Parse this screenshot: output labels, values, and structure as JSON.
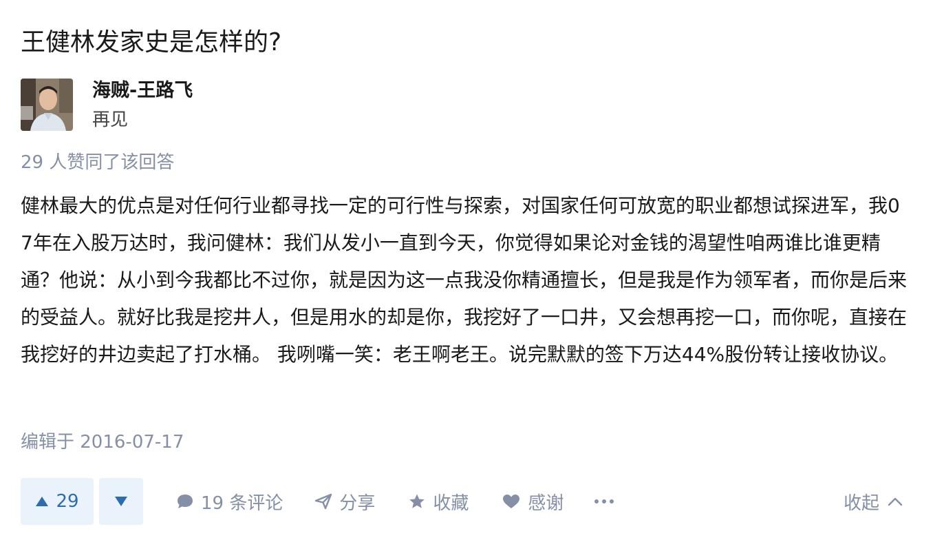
{
  "question": {
    "title": "王健林发家史是怎样的?"
  },
  "author": {
    "name": "海贼-王路飞",
    "bio": "再见"
  },
  "vote_summary": "29 人赞同了该回答",
  "answer": {
    "paragraph": "健林最大的优点是对任何行业都寻找一定的可行性与探索，对国家任何可放宽的职业都想试探进军，我07年在入股万达时，我问健林：我们从发小一直到今天，你觉得如果论对金钱的渴望性咱两谁比谁更精通？他说：从小到今我都比不过你，就是因为这一点我没你精通擅长，但是我是作为领军者，而你是后来的受益人。就好比我是挖井人，但是用水的却是你，我挖好了一口井，又会想再挖一口，而你呢，直接在我挖好的井边卖起了打水桶。 我咧嘴一笑：老王啊老王。说完默默的签下万达44%股份转让接收协议。"
  },
  "edit_time": "编辑于 2016-07-17",
  "actions": {
    "upvote_count": "29",
    "comment_label": "19 条评论",
    "share_label": "分享",
    "favorite_label": "收藏",
    "thanks_label": "感谢",
    "collapse_label": "收起"
  },
  "icons": {
    "upvote": "triangle-up-icon",
    "downvote": "triangle-down-icon",
    "comment": "speech-bubble-icon",
    "share": "paper-plane-icon",
    "favorite": "star-icon",
    "thanks": "heart-icon",
    "more": "ellipsis-icon",
    "collapse": "chevron-up-icon"
  },
  "colors": {
    "accent": "#2b6dad",
    "vote_bg": "#eaf2fb",
    "muted": "#8590a6",
    "text": "#1a1a1a"
  }
}
